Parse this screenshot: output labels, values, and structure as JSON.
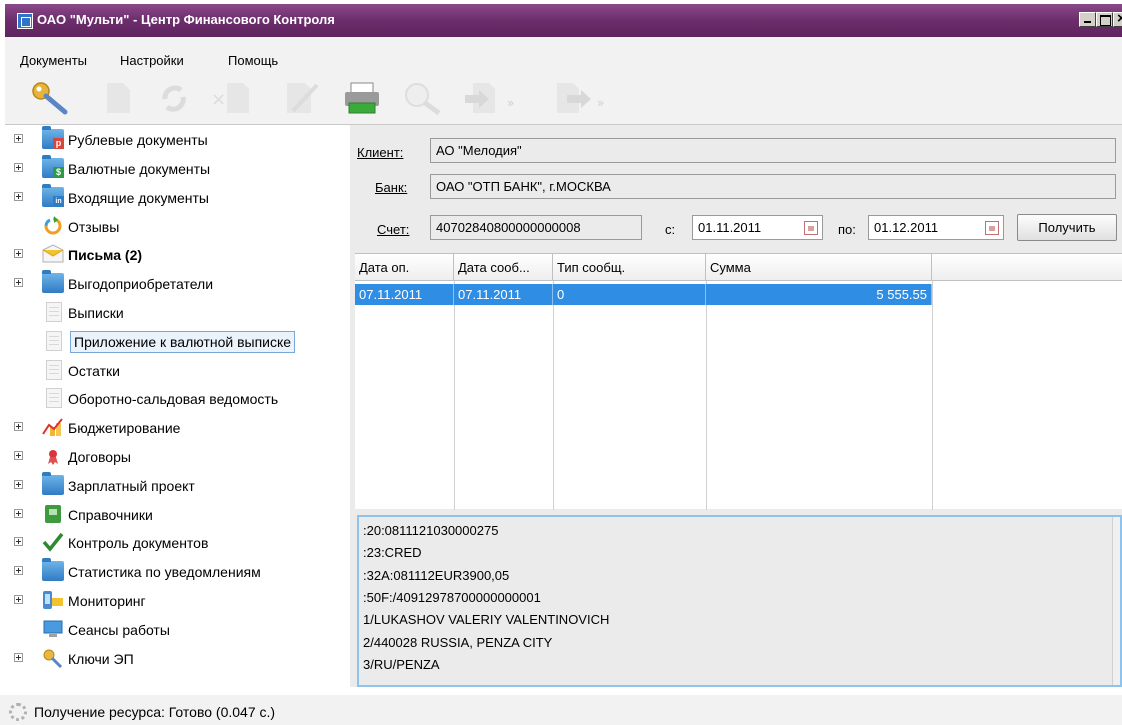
{
  "window": {
    "title": "ОАО \"Мульти\" - Центр Финансового Контроля"
  },
  "menu": [
    "Документы",
    "Настройки",
    "Помощь"
  ],
  "toolbar": {
    "icons": [
      "key-icon",
      "document-icon",
      "refresh-icon",
      "delete-icon",
      "sign-icon",
      "edit-icon",
      "print-icon",
      "search-icon",
      "import-icon",
      "export-icon"
    ]
  },
  "tree": [
    {
      "label": "Рублевые документы",
      "icon": "ruble-folder-icon",
      "expandable": true,
      "bold": false,
      "badge": "р",
      "color": "#d9463b"
    },
    {
      "label": "Валютные документы",
      "icon": "currency-folder-icon",
      "expandable": true,
      "bold": false,
      "badge": "$",
      "color": "#2e9a45"
    },
    {
      "label": "Входящие документы",
      "icon": "incoming-folder-icon",
      "expandable": true,
      "bold": false,
      "badge": "in",
      "color": "#2f7bc4"
    },
    {
      "label": "Отзывы",
      "icon": "recall-icon",
      "expandable": false,
      "bold": false
    },
    {
      "label": "Письма (2)",
      "icon": "envelope-icon",
      "expandable": true,
      "bold": true
    },
    {
      "label": "Выгодоприобретатели",
      "icon": "folder-icon",
      "expandable": true,
      "bold": false
    },
    {
      "label": "Выписки",
      "icon": "statement-document-icon",
      "expandable": false,
      "bold": false
    },
    {
      "label": "Приложение к валютной выписке",
      "icon": "document-icon",
      "expandable": false,
      "bold": false,
      "selected": true
    },
    {
      "label": "Остатки",
      "icon": "document-icon",
      "expandable": false,
      "bold": false
    },
    {
      "label": "Оборотно-сальдовая ведомость",
      "icon": "document-icon",
      "expandable": false,
      "bold": false
    },
    {
      "label": "Бюджетирование",
      "icon": "budget-chart-icon",
      "expandable": true,
      "bold": false
    },
    {
      "label": "Договоры",
      "icon": "contract-icon",
      "expandable": true,
      "bold": false
    },
    {
      "label": "Зарплатный проект",
      "icon": "folder-icon",
      "expandable": true,
      "bold": false
    },
    {
      "label": "Справочники",
      "icon": "book-icon",
      "expandable": true,
      "bold": false
    },
    {
      "label": "Контроль документов",
      "icon": "checkmark-icon",
      "expandable": true,
      "bold": false
    },
    {
      "label": "Статистика по уведомлениям",
      "icon": "folder-icon",
      "expandable": true,
      "bold": false
    },
    {
      "label": "Мониторинг",
      "icon": "monitoring-icon",
      "expandable": true,
      "bold": false
    },
    {
      "label": "Сеансы работы",
      "icon": "monitor-icon",
      "expandable": false,
      "bold": false
    },
    {
      "label": "Ключи ЭП",
      "icon": "keys-icon",
      "expandable": true,
      "bold": false
    }
  ],
  "form": {
    "client_label": "Клиент:",
    "client_value": "АО \"Мелодия\"",
    "bank_label": "Банк:",
    "bank_value": "ОАО \"ОТП БАНК\", г.МОСКВА",
    "account_label": "Счет:",
    "account_value": "40702840800000000008",
    "from_label": "с:",
    "from_value": "01.11.2011",
    "to_label": "по:",
    "to_value": "01.12.2011",
    "get_button": "Получить"
  },
  "table": {
    "columns": [
      "Дата оп.",
      "Дата сооб...",
      "Тип сообщ.",
      "Сумма"
    ],
    "rows": [
      [
        "07.11.2011",
        "07.11.2011",
        "0",
        "5 555.55"
      ]
    ]
  },
  "message_lines": [
    ":20:0811121030000275",
    ":23:CRED",
    ":32A:081112EUR3900,05",
    ":50F:/40912978700000000001",
    "1/LUKASHOV VALERIY VALENTINOVICH",
    "2/440028 RUSSIA, PENZA CITY",
    "3/RU/PENZA"
  ],
  "status": {
    "text": "Получение ресурса: Готово (0.047 с.)"
  }
}
